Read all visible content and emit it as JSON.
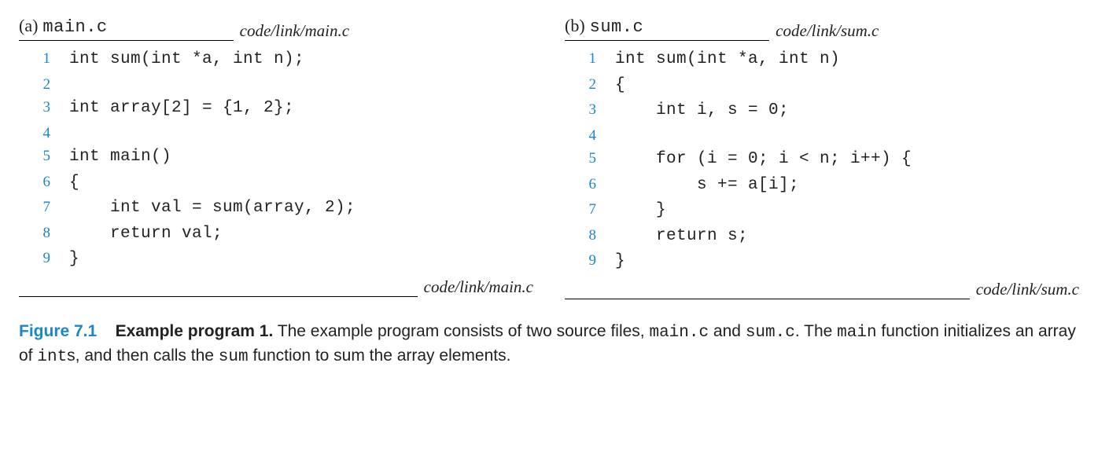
{
  "left": {
    "label": "(a)",
    "filename": "main.c",
    "path": "code/link/main.c",
    "lines": [
      "int sum(int *a, int n);",
      "",
      "int array[2] = {1, 2};",
      "",
      "int main()",
      "{",
      "    int val = sum(array, 2);",
      "    return val;",
      "}"
    ]
  },
  "right": {
    "label": "(b)",
    "filename": "sum.c",
    "path": "code/link/sum.c",
    "lines": [
      "int sum(int *a, int n)",
      "{",
      "    int i, s = 0;",
      "",
      "    for (i = 0; i < n; i++) {",
      "        s += a[i];",
      "    }",
      "    return s;",
      "}"
    ]
  },
  "caption": {
    "figure_label": "Figure 7.1",
    "title": "Example program 1.",
    "text_1": " The example program consists of two source files, ",
    "mono_1": "main.c",
    "text_2": " and ",
    "mono_2": "sum.c",
    "text_3": ". The ",
    "mono_3": "main",
    "text_4": " function initializes an array of ",
    "mono_4": "int",
    "text_5": "s, and then calls the ",
    "mono_5": "sum",
    "text_6": " function to sum the array elements."
  }
}
